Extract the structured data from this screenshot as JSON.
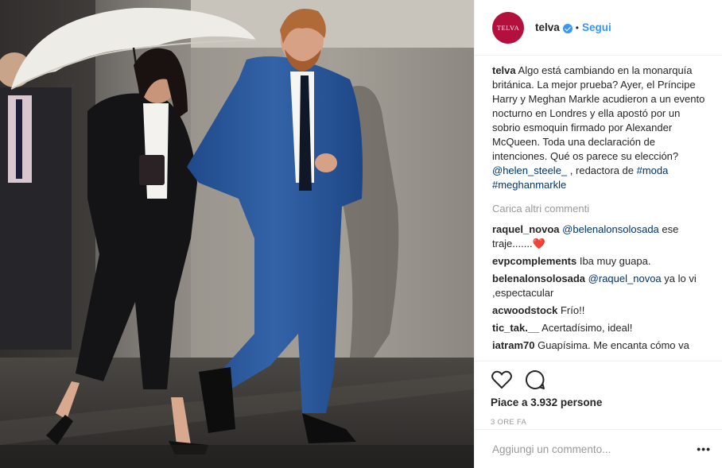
{
  "post": {
    "username": "telva",
    "avatar_text": "TELVA",
    "follow_label": "Segui",
    "dot": "•"
  },
  "caption": {
    "username": "telva",
    "text": "Algo está cambiando en la monarquía británica. La mejor prueba? Ayer, el Príncipe Harry y Meghan Markle acudieron a un evento nocturno en Londres y ella apostó por un sobrio esmoquin firmado por Alexander McQueen. Toda una declaración de intenciones. Qué os parece su elección?",
    "mention": "@helen_steele_",
    "mid_text": ", redactora de",
    "hashtag1": "#moda",
    "hashtag2": "#meghanmarkle"
  },
  "load_more": "Carica altri commenti",
  "comments": [
    {
      "username": "raquel_novoa",
      "mention": "@belenalonsolosada",
      "text": "ese traje.......",
      "emoji": "❤️"
    },
    {
      "username": "evpcomplements",
      "text": "Iba muy guapa."
    },
    {
      "username": "belenalonsolosada",
      "mention": "@raquel_novoa",
      "text": "ya lo vi ,espectacular"
    },
    {
      "username": "acwoodstock",
      "text": "Frío!!"
    },
    {
      "username": "tic_tak.__",
      "text": "Acertadísimo, ideal!"
    },
    {
      "username": "iatram70",
      "text": "Guapísima. Me encanta cómo va"
    }
  ],
  "likes": "Piace a 3.932 persone",
  "time": "3 ORE FA",
  "add_comment": {
    "placeholder": "Aggiungi un commento..."
  },
  "more_label": "•••",
  "icons": {
    "like": "heart-icon",
    "comment": "comment-bubble-icon",
    "verified": "verified-badge-icon",
    "more": "more-options-icon"
  },
  "colors": {
    "follow": "#3897f0",
    "link": "#003569",
    "avatar": "#b3103d",
    "muted": "#999999"
  }
}
